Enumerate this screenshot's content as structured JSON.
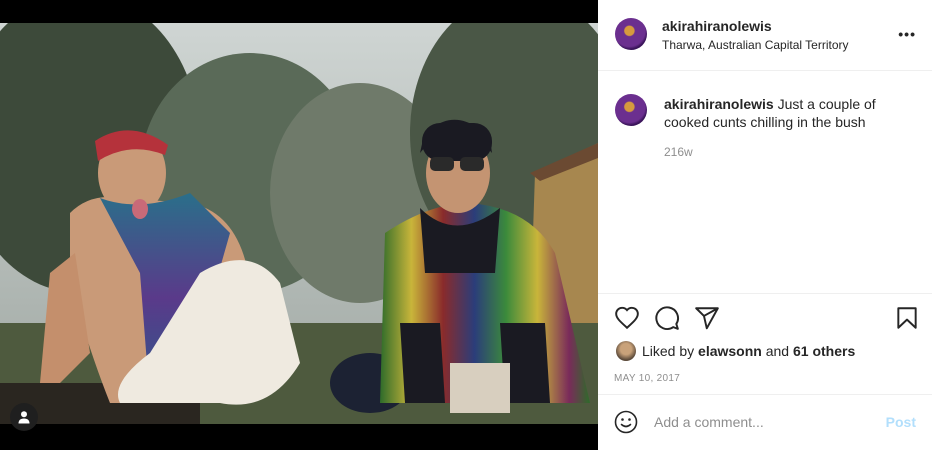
{
  "header": {
    "username": "akirahiranolewis",
    "location": "Tharwa, Australian Capital Territory",
    "more_icon": "more-horizontal-icon"
  },
  "caption": {
    "username": "akirahiranolewis",
    "text": "Just a couple of cooked cunts chilling in the bush",
    "age": "216w"
  },
  "actions": {
    "icons": [
      "heart-icon",
      "comment-icon",
      "share-icon",
      "bookmark-icon"
    ]
  },
  "likes": {
    "prefix": "Liked by",
    "user": "elawsonn",
    "connector": "and",
    "others": "61 others"
  },
  "date": "MAY 10, 2017",
  "comment": {
    "placeholder": "Add a comment...",
    "post_label": "Post"
  },
  "colors": {
    "post_button": "#b2dffc",
    "muted_text": "#8e8e8e",
    "text": "#262626"
  }
}
